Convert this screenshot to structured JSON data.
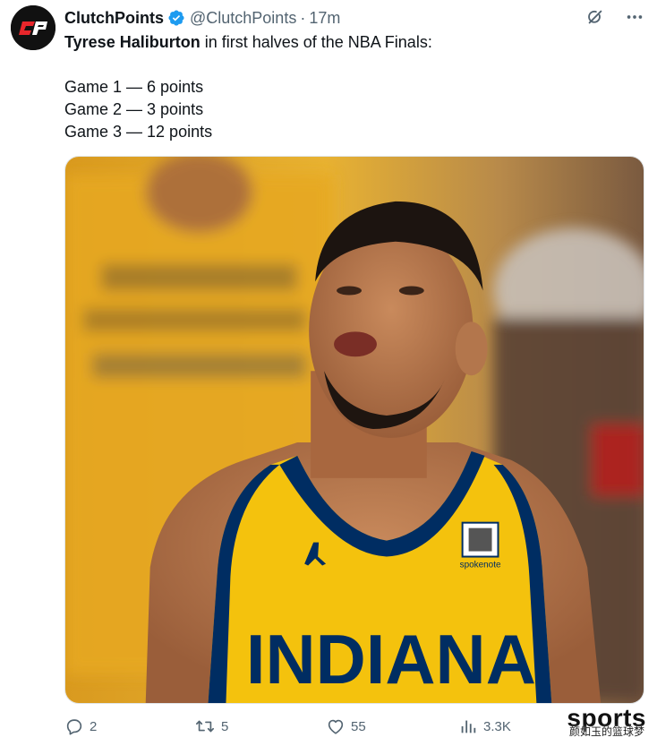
{
  "author": {
    "display_name": "ClutchPoints",
    "handle": "@ClutchPoints",
    "separator": "·",
    "time": "17m",
    "avatar_icon": "clutchpoints-logo",
    "avatar_initials": "CP"
  },
  "top_icons": [
    "grok-icon",
    "more-icon"
  ],
  "tweet": {
    "bold_name": "Tyrese Haliburton",
    "headline_rest": " in first halves of the NBA Finals:",
    "lines": [
      "Game 1 — 6 points",
      "Game 2 — 3 points",
      "Game 3 — 12 points"
    ]
  },
  "media": {
    "jersey_text": "INDIANA",
    "sponsor_text": "spokenote",
    "colors": {
      "jersey": "#f4c20d",
      "trim": "#002d62",
      "background": "#e0a826"
    }
  },
  "actions": {
    "reply_count": "2",
    "retweet_count": "5",
    "like_count": "55",
    "views_count": "3.3K"
  },
  "watermark": {
    "main": "sports",
    "sub": "颜如玉的篮球梦"
  },
  "colors": {
    "verified_badge": "#1d9bf0",
    "secondary_text": "#536471"
  }
}
